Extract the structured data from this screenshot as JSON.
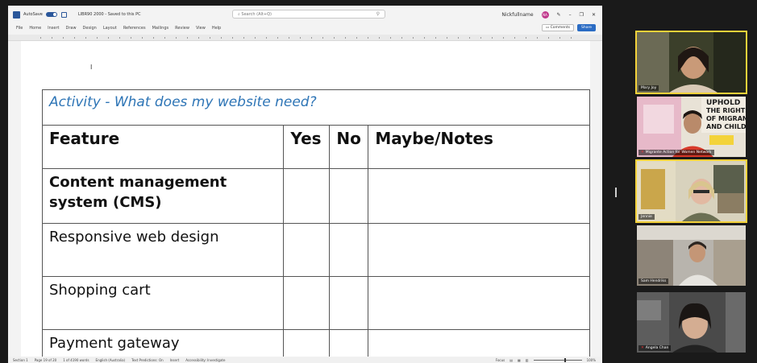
{
  "word": {
    "autosave_label": "AutoSave",
    "doc_title": "LIBR90 2000 - Saved to this PC",
    "search_placeholder": "Search (Alt+Q)",
    "user_name": "Nickfullname",
    "user_initials": "NA",
    "ribbon_tabs": [
      "File",
      "Home",
      "Insert",
      "Draw",
      "Design",
      "Layout",
      "References",
      "Mailings",
      "Review",
      "View",
      "Help"
    ],
    "comments_label": "Comments",
    "share_label": "Share",
    "status_items": [
      "Section 1",
      "Page 19 of 20",
      "1 of 4190 words",
      "English (Australia)",
      "Text Predictions: On",
      "Insert",
      "Accessibility: Investigate"
    ],
    "focus_label": "Focus",
    "zoom": "100%"
  },
  "document": {
    "title_mark": "I",
    "activity_title": "Activity - What does my website need?",
    "headers": [
      "Feature",
      "Yes",
      "No",
      "Maybe/Notes"
    ],
    "rows": [
      {
        "feature": "Content management system (CMS)",
        "bold": true
      },
      {
        "feature": "Responsive web design",
        "bold": false
      },
      {
        "feature": "Shopping cart",
        "bold": false
      },
      {
        "feature": "Payment gateway",
        "bold": false
      }
    ]
  },
  "participants": [
    {
      "name": "Mary Joy",
      "muted": false,
      "active": true
    },
    {
      "name": "Migrante Action for Women Network",
      "muted": true,
      "active": false
    },
    {
      "name": "Jennie",
      "muted": false,
      "active": true
    },
    {
      "name": "Sam Hendriks",
      "muted": false,
      "active": false
    },
    {
      "name": "Angela Chan",
      "muted": true,
      "active": false
    }
  ],
  "colors": {
    "word_blue": "#2b579a",
    "activity_blue": "#2e75b6",
    "speaker_outline": "#f4d23a"
  }
}
